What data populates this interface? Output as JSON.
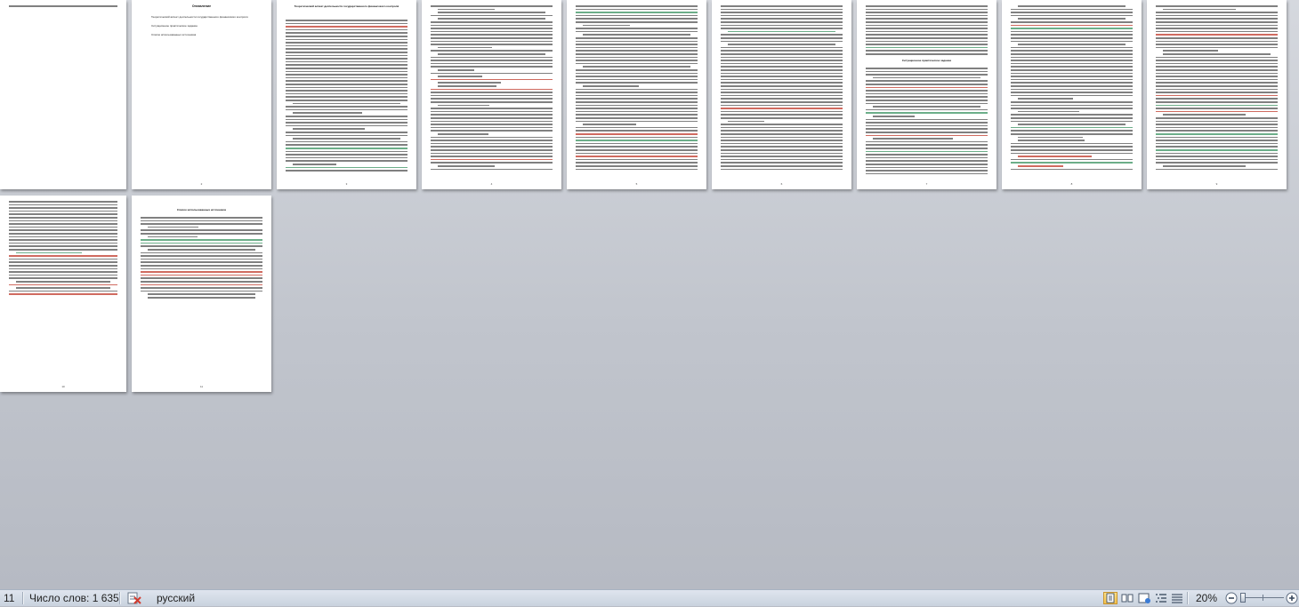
{
  "document": {
    "pages": [
      {
        "title": "",
        "number": "",
        "lines": 1,
        "page_kind": "cut-left"
      },
      {
        "title": "Оглавление",
        "number": "2",
        "page_kind": "toc",
        "toc": [
          "Теоретический аспект деятельности государственного финансового контроля",
          "Ситуационное практическое задание",
          "Список использованных источников"
        ]
      },
      {
        "title": "Теоретический аспект деятельности государственного финансового контроля",
        "number": "3",
        "lines": 48
      },
      {
        "title": "",
        "number": "4",
        "lines": 52
      },
      {
        "title": "",
        "number": "5",
        "lines": 52
      },
      {
        "title": "",
        "number": "6",
        "lines": 52
      },
      {
        "title": "Ситуационное практическое задание",
        "number": "7",
        "lines": 52
      },
      {
        "title": "",
        "number": "8",
        "lines": 52
      },
      {
        "title": "",
        "number": "9",
        "lines": 52
      },
      {
        "title": "",
        "number": "10",
        "lines": 30,
        "page_kind": "cut-left"
      },
      {
        "title": "Список использованных источников",
        "number": "11",
        "lines": 26
      }
    ]
  },
  "status_bar": {
    "page_info": "11",
    "word_count": "Число слов: 1 635",
    "proofing_icon": "spellcheck-error-icon",
    "language": "русский",
    "zoom_percent": "20%",
    "zoom_level": 0.2,
    "view_buttons": [
      {
        "name": "print-layout-view",
        "active": true
      },
      {
        "name": "full-screen-reading-view",
        "active": false
      },
      {
        "name": "web-layout-view",
        "active": false
      },
      {
        "name": "outline-view",
        "active": false
      },
      {
        "name": "draft-view",
        "active": false
      }
    ]
  }
}
